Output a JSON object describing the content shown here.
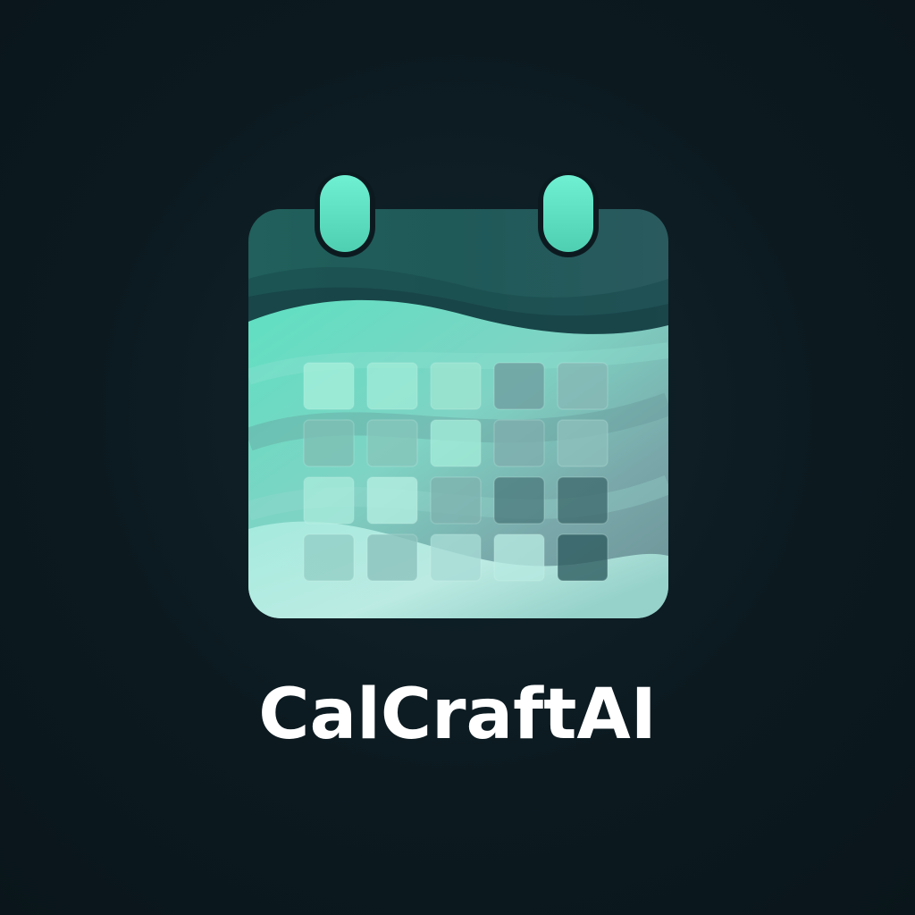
{
  "brand": {
    "name": "CalCraftAI"
  },
  "icons": {
    "logo": "calendar-icon"
  },
  "colors": {
    "background": "#0c1a20",
    "header_dark": "#1f5856",
    "accent_mint": "#5fe0c2",
    "grid_light": "#a4ead9",
    "grid_dark": "#2c5a5c",
    "wordmark": "#ffffff"
  },
  "calendar_grid": {
    "rows": 4,
    "cols": 5
  }
}
